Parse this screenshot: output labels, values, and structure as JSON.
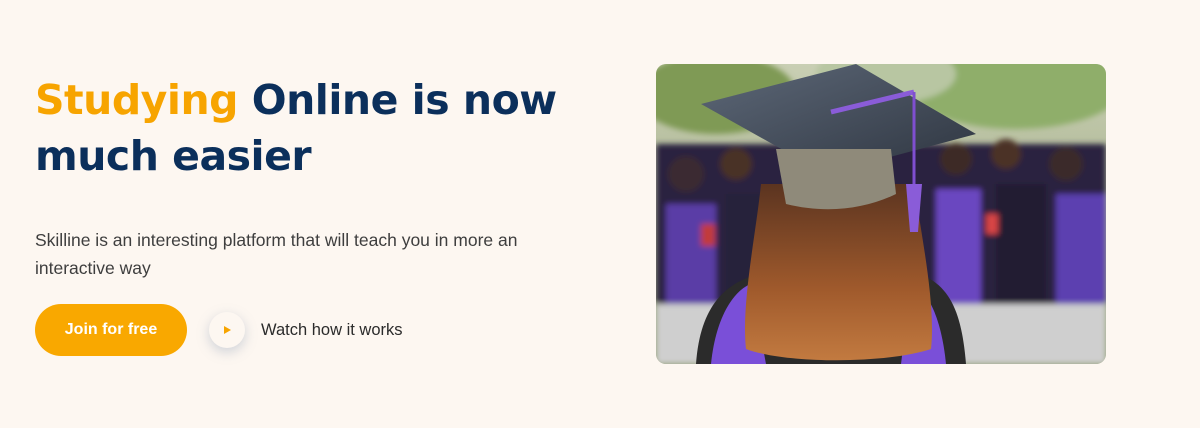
{
  "hero": {
    "title_accent": "Studying",
    "title_rest": " Online is now much easier",
    "description": "Skilline is an interesting platform that will teach you in more an interactive way",
    "join_button": "Join for free",
    "watch_label": "Watch how it works",
    "image_alt": "graduate-in-cap-photo"
  },
  "colors": {
    "background": "#fdf7f1",
    "accent": "#f9a800",
    "title_navy": "#0b2f5b",
    "play_icon": "#f7a400"
  },
  "icons": {
    "play": "play-icon"
  }
}
